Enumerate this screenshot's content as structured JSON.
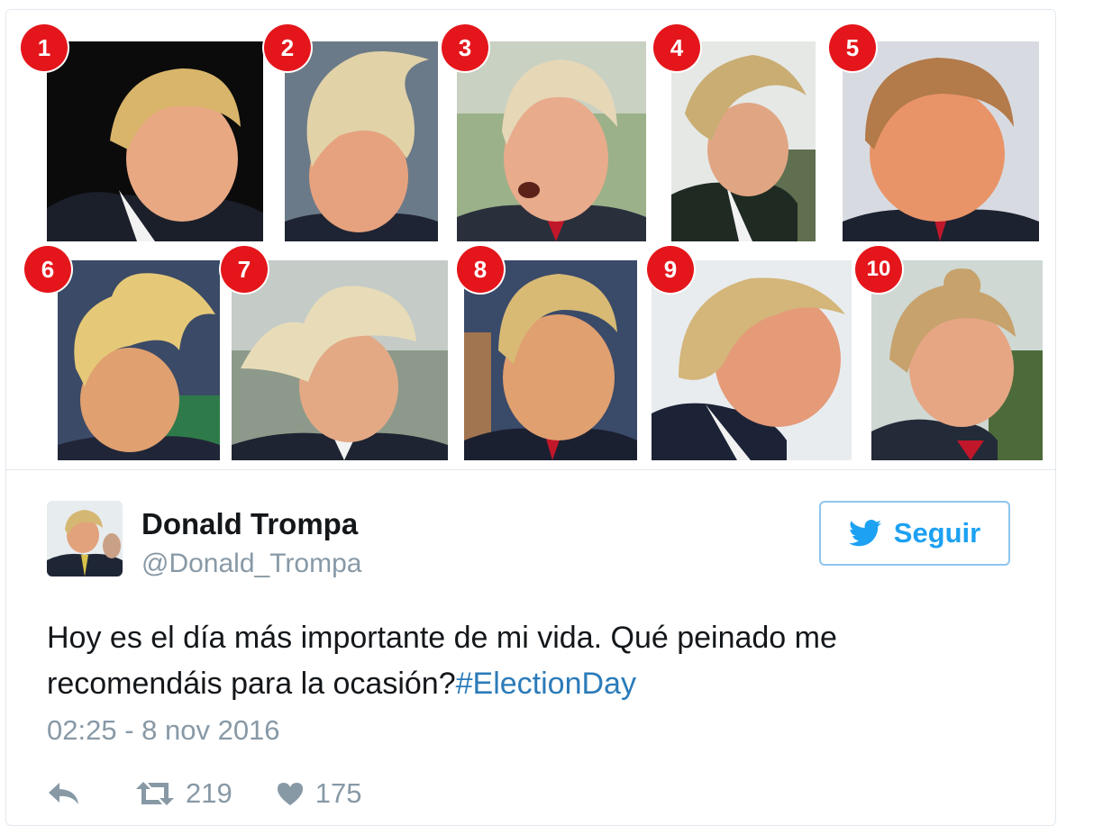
{
  "photos": {
    "numbers": [
      "1",
      "2",
      "3",
      "4",
      "5",
      "6",
      "7",
      "8",
      "9",
      "10"
    ]
  },
  "tweet": {
    "display_name": "Donald Trompa",
    "handle": "@Donald_Trompa",
    "follow_label": "Seguir",
    "text": "Hoy es el día más importante de mi vida. Qué peinado me recomendáis para la ocasión?",
    "hashtag": "#ElectionDay",
    "timestamp": "02:25 - 8 nov 2016",
    "retweet_count": "219",
    "like_count": "175"
  },
  "colors": {
    "badge": "#e4161b",
    "twitter_blue": "#1da1f2",
    "hashtag": "#2b7bb9",
    "muted": "#8899a6"
  },
  "icons": [
    "reply-icon",
    "retweet-icon",
    "heart-icon",
    "twitter-bird-icon"
  ]
}
